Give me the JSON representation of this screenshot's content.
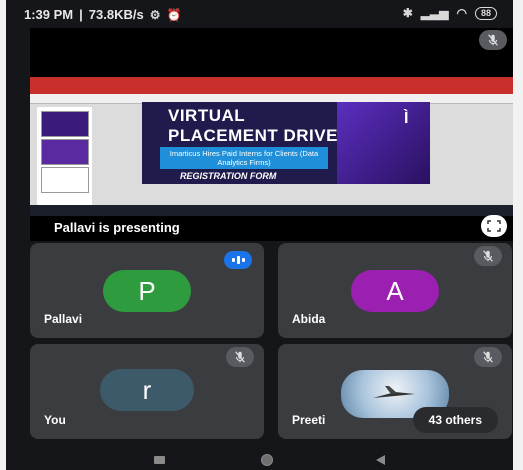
{
  "status": {
    "time": "1:39 PM",
    "speed": "73.8KB/s",
    "battery": "88"
  },
  "presentation": {
    "label": "Pallavi is presenting",
    "slide_title_1": "VIRTUAL",
    "slide_title_2": "PLACEMENT DRIVE",
    "slide_box": "Imarticus Hires Paid Interns for Clients (Data Analytics Firms)",
    "slide_reg": "REGISTRATION FORM"
  },
  "participants": [
    {
      "name": "Pallavi",
      "initial": "P",
      "color": "#2e9b3e",
      "speaking": true
    },
    {
      "name": "Abida",
      "initial": "A",
      "color": "#9b1fb0",
      "muted": true
    },
    {
      "name": "You",
      "initial": "r",
      "color": "#3d5a6a",
      "muted": true
    },
    {
      "name": "Preeti",
      "muted": true
    }
  ],
  "others_label": "43 others",
  "icons": [
    "mic-off-icon",
    "fullscreen-icon",
    "speaking-icon",
    "nav-recents-icon",
    "nav-home-icon",
    "nav-back-icon"
  ]
}
